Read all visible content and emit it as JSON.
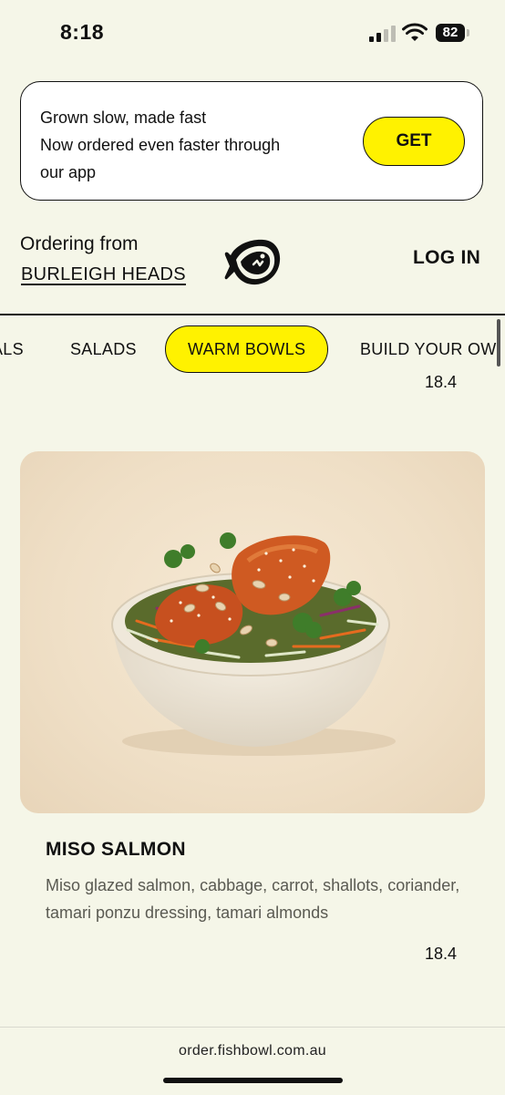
{
  "status_bar": {
    "time": "8:18",
    "battery": "82"
  },
  "banner": {
    "lines": [
      "Grown slow, made fast",
      "Now ordered even faster through",
      "our app"
    ],
    "button": "GET"
  },
  "header": {
    "ordering_label": "Ordering from",
    "location": "BURLEIGH HEADS",
    "login": "LOG IN"
  },
  "tabs": [
    {
      "label": "ALS"
    },
    {
      "label": "SALADS"
    },
    {
      "label": "WARM BOWLS",
      "active": true
    },
    {
      "label": "BUILD YOUR OW"
    }
  ],
  "previous_item": {
    "price": "18.4"
  },
  "product": {
    "name": "MISO SALMON",
    "description": "Miso glazed salmon, cabbage, carrot, shallots, coriander, tamari ponzu dressing, tamari almonds",
    "price": "18.4"
  },
  "footer": {
    "url": "order.fishbowl.com.au"
  },
  "colors": {
    "accent": "#fff200",
    "background": "#f5f6e8",
    "ink": "#111111"
  },
  "icons": [
    "signal-icon",
    "wifi-icon",
    "battery-icon",
    "fish-logo-icon"
  ]
}
